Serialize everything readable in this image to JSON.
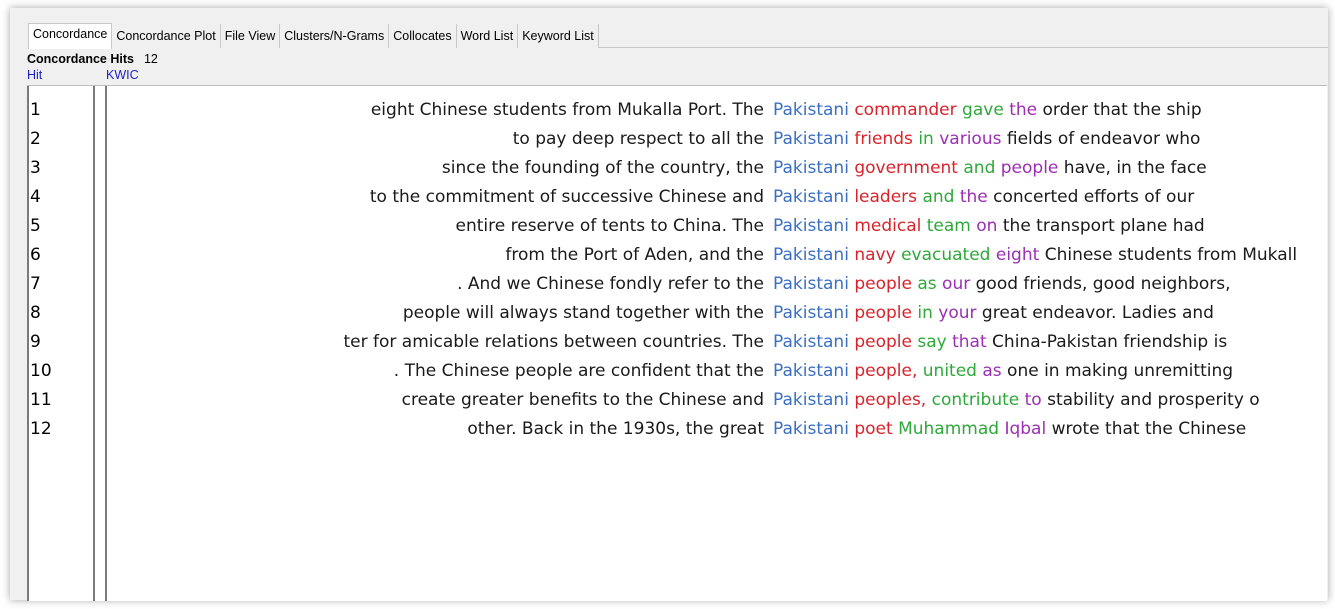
{
  "tabs": [
    "Concordance",
    "Concordance Plot",
    "File View",
    "Clusters/N-Grams",
    "Collocates",
    "Word List",
    "Keyword List"
  ],
  "active_tab": 0,
  "hits_label": "Concordance Hits",
  "hits_count": "12",
  "columns": {
    "hit": "Hit",
    "kwic": "KWIC"
  },
  "colors": {
    "node": "#3a6fc4",
    "r1": "#d9232b",
    "r2": "#2ea83a",
    "r3": "#9b2fb3",
    "header": "#1e22c8"
  },
  "rows": [
    {
      "hit": "1",
      "left": "eight Chinese students from Mukalla Port. The",
      "node": "Pakistani",
      "r1": "commander",
      "r2": "gave",
      "r3": "the",
      "rest": "order that the ship"
    },
    {
      "hit": "2",
      "left": "to pay deep respect to all the",
      "node": "Pakistani",
      "r1": "friends",
      "r2": "in",
      "r3": "various",
      "rest": "fields of endeavor who"
    },
    {
      "hit": "3",
      "left": "since the founding of the country, the",
      "node": "Pakistani",
      "r1": "government",
      "r2": "and",
      "r3": "people",
      "rest": "have, in the face"
    },
    {
      "hit": "4",
      "left": "to the commitment of successive Chinese and",
      "node": "Pakistani",
      "r1": "leaders",
      "r2": "and",
      "r3": "the",
      "rest": "concerted efforts of our"
    },
    {
      "hit": "5",
      "left": "entire reserve of tents to China. The",
      "node": "Pakistani",
      "r1": "medical",
      "r2": "team",
      "r3": "on",
      "rest": "the transport plane had"
    },
    {
      "hit": "6",
      "left": "from the Port of Aden, and the",
      "node": "Pakistani",
      "r1": "navy",
      "r2": "evacuated",
      "r3": "eight",
      "rest": "Chinese students from Mukall"
    },
    {
      "hit": "7",
      "left": ". And we Chinese fondly refer to the",
      "node": "Pakistani",
      "r1": "people",
      "r2": "as",
      "r3": "our",
      "rest": "good friends, good neighbors,"
    },
    {
      "hit": "8",
      "left": "people will always stand together with the",
      "node": "Pakistani",
      "r1": "people",
      "r2": "in",
      "r3": "your",
      "rest": "great endeavor. Ladies and"
    },
    {
      "hit": "9",
      "left": "ter for amicable relations between countries. The",
      "node": "Pakistani",
      "r1": "people",
      "r2": "say",
      "r3": "that",
      "rest": "China-Pakistan friendship is"
    },
    {
      "hit": "10",
      "left": ". The Chinese people are confident that the",
      "node": "Pakistani",
      "r1": "people,",
      "r2": "united",
      "r3": "as",
      "rest": "one in making unremitting"
    },
    {
      "hit": "11",
      "left": "create greater benefits to the Chinese and",
      "node": "Pakistani",
      "r1": "peoples,",
      "r2": "contribute",
      "r3": "to",
      "rest": "stability and prosperity o"
    },
    {
      "hit": "12",
      "left": "other. Back in the 1930s, the great",
      "node": "Pakistani",
      "r1": "poet",
      "r2": "Muhammad",
      "r3": "Iqbal",
      "rest": "wrote that the Chinese"
    }
  ]
}
